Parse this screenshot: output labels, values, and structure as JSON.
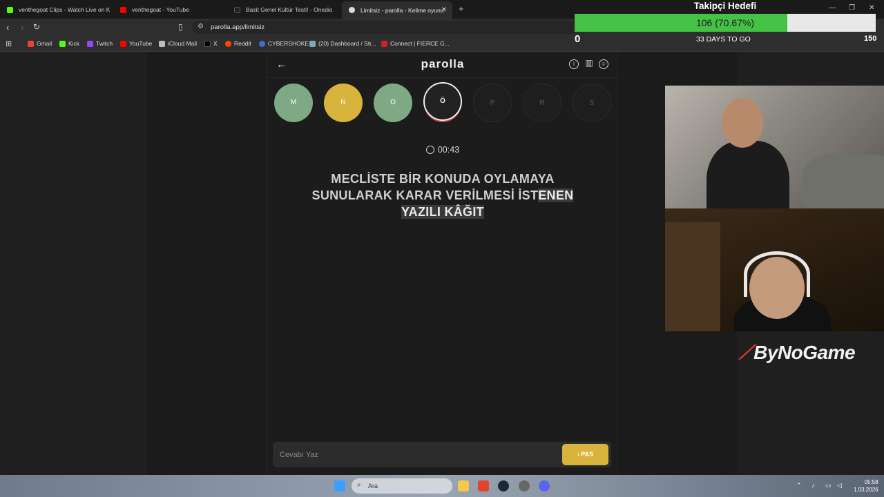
{
  "browser": {
    "tabs": [
      {
        "label": "venthegoat Clips - Watch Live on Kick",
        "color": "#53fc18"
      },
      {
        "label": "venthegoat - YouTube",
        "color": "#ff0000"
      },
      {
        "label": "Basit Genel Kültür Testi! - Onedio",
        "color": "#222222"
      },
      {
        "label": "Limitsiz - parolla - Kelime oyunu",
        "color": "#dddddd"
      }
    ],
    "url": "parolla.app/limitsiz",
    "bookmarks": [
      {
        "label": "Gmail",
        "color": "#ea4335"
      },
      {
        "label": "Kick",
        "color": "#53fc18"
      },
      {
        "label": "Twitch",
        "color": "#9146ff"
      },
      {
        "label": "YouTube",
        "color": "#ff0000"
      },
      {
        "label": "iCloud Mail",
        "color": "#bbbbbb"
      },
      {
        "label": "X",
        "color": "#000000"
      },
      {
        "label": "Reddit",
        "color": "#ff4500"
      },
      {
        "label": "CYBERSHOKE",
        "color": "#3b6fd1"
      },
      {
        "label": "(20) Dashboard / Str...",
        "color": "#7ab"
      },
      {
        "label": "Connect | FIERCE G...",
        "color": "#c22"
      }
    ]
  },
  "app": {
    "logo": "parolla",
    "letters": [
      {
        "letter": "M",
        "state": "correct"
      },
      {
        "letter": "N",
        "state": "passed"
      },
      {
        "letter": "O",
        "state": "correct"
      },
      {
        "letter": "Ö",
        "state": "current"
      },
      {
        "letter": "P",
        "state": "pending"
      },
      {
        "letter": "R",
        "state": "pending"
      },
      {
        "letter": "S",
        "state": "pending"
      }
    ],
    "timer": "00:43",
    "question_part1": "MECLİSTE BİR KONUDA OYLAMAYA SUNULARAK KARAR VERİLMESİ İST",
    "question_part2": "ENEN YAZILI KÂĞIT",
    "answer_placeholder": "Cevabı Yaz",
    "pass_label": "PAS"
  },
  "overlay": {
    "goal_title": "Takipçi Hedefi",
    "goal_text": "106 (70.67%)",
    "goal_progress": 0.7067,
    "goal_min": "0",
    "goal_days": "33 DAYS TO GO",
    "goal_max": "150",
    "sponsor": "ByNoGame"
  },
  "taskbar": {
    "search_label": "Ara",
    "time": "05:58",
    "date": "1.03.2026"
  },
  "colors": {
    "correct": "#7fa985",
    "passed": "#d9b43c",
    "goal_fill": "#45c245"
  }
}
